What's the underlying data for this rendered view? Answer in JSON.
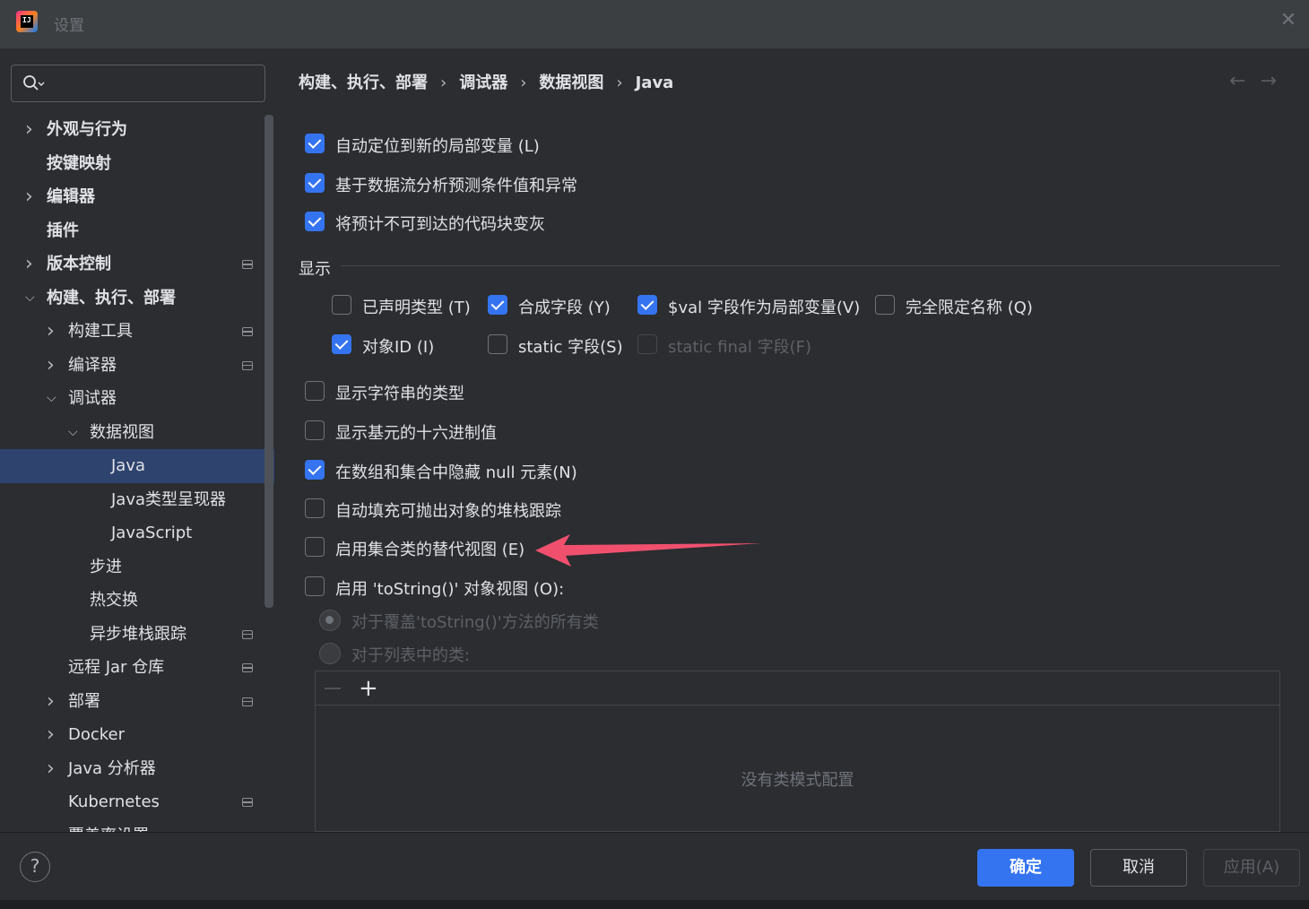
{
  "window": {
    "title": "设置"
  },
  "search": {
    "placeholder": ""
  },
  "sidebar": {
    "items": [
      {
        "label": "外观与行为",
        "bold": true,
        "chevron": "right",
        "indent": 0,
        "pin": false
      },
      {
        "label": "按键映射",
        "bold": true,
        "chevron": "",
        "indent": 0,
        "pin": false
      },
      {
        "label": "编辑器",
        "bold": true,
        "chevron": "right",
        "indent": 0,
        "pin": false
      },
      {
        "label": "插件",
        "bold": true,
        "chevron": "",
        "indent": 0,
        "pin": false
      },
      {
        "label": "版本控制",
        "bold": true,
        "chevron": "right",
        "indent": 0,
        "pin": true
      },
      {
        "label": "构建、执行、部署",
        "bold": true,
        "chevron": "down",
        "indent": 0,
        "pin": false
      },
      {
        "label": "构建工具",
        "bold": false,
        "chevron": "right",
        "indent": 1,
        "pin": true
      },
      {
        "label": "编译器",
        "bold": false,
        "chevron": "right",
        "indent": 1,
        "pin": true
      },
      {
        "label": "调试器",
        "bold": false,
        "chevron": "down",
        "indent": 1,
        "pin": false
      },
      {
        "label": "数据视图",
        "bold": false,
        "chevron": "down",
        "indent": 2,
        "pin": false
      },
      {
        "label": "Java",
        "bold": false,
        "chevron": "",
        "indent": 3,
        "pin": false,
        "selected": true
      },
      {
        "label": "Java类型呈现器",
        "bold": false,
        "chevron": "",
        "indent": 3,
        "pin": false
      },
      {
        "label": "JavaScript",
        "bold": false,
        "chevron": "",
        "indent": 3,
        "pin": false
      },
      {
        "label": "步进",
        "bold": false,
        "chevron": "",
        "indent": 2,
        "pin": false
      },
      {
        "label": "热交换",
        "bold": false,
        "chevron": "",
        "indent": 2,
        "pin": false
      },
      {
        "label": "异步堆栈跟踪",
        "bold": false,
        "chevron": "",
        "indent": 2,
        "pin": true
      },
      {
        "label": "远程 Jar 仓库",
        "bold": false,
        "chevron": "",
        "indent": 1,
        "pin": true
      },
      {
        "label": "部署",
        "bold": false,
        "chevron": "right",
        "indent": 1,
        "pin": true
      },
      {
        "label": "Docker",
        "bold": false,
        "chevron": "right",
        "indent": 1,
        "pin": false
      },
      {
        "label": "Java 分析器",
        "bold": false,
        "chevron": "right",
        "indent": 1,
        "pin": false
      },
      {
        "label": "Kubernetes",
        "bold": false,
        "chevron": "",
        "indent": 1,
        "pin": true
      },
      {
        "label": "覆盖率设置",
        "bold": false,
        "chevron": "",
        "indent": 1,
        "pin": false
      }
    ]
  },
  "breadcrumb": [
    "构建、执行、部署",
    "调试器",
    "数据视图",
    "Java"
  ],
  "nav": {
    "back": "←",
    "forward": "→"
  },
  "options_top": [
    {
      "label": "自动定位到新的局部变量 (L)",
      "checked": true
    },
    {
      "label": "基于数据流分析预测条件值和异常",
      "checked": true
    },
    {
      "label": "将预计不可到达的代码块变灰",
      "checked": true
    }
  ],
  "display": {
    "title": "显示",
    "row1": [
      {
        "label": "已声明类型 (T)",
        "checked": false,
        "disabled": false
      },
      {
        "label": "合成字段 (Y)",
        "checked": true,
        "disabled": false
      },
      {
        "label": "$val 字段作为局部变量(V)",
        "checked": true,
        "disabled": false
      },
      {
        "label": "完全限定名称 (Q)",
        "checked": false,
        "disabled": false
      }
    ],
    "row2": [
      {
        "label": "对象ID (I)",
        "checked": true,
        "disabled": false
      },
      {
        "label": "static 字段(S)",
        "checked": false,
        "disabled": false
      },
      {
        "label": "static final 字段(F)",
        "checked": false,
        "disabled": true
      }
    ]
  },
  "options_mid": [
    {
      "label": "显示字符串的类型",
      "checked": false
    },
    {
      "label": "显示基元的十六进制值",
      "checked": false
    },
    {
      "label": "在数组和集合中隐藏 null 元素(N)",
      "checked": true
    },
    {
      "label": "自动填充可抛出对象的堆栈跟踪",
      "checked": false
    },
    {
      "label": "启用集合类的替代视图 (E)",
      "checked": false
    },
    {
      "label": "启用 'toString()' 对象视图 (O):",
      "checked": false
    }
  ],
  "radios": [
    {
      "label": "对于覆盖'toString()'方法的所有类",
      "selected": true
    },
    {
      "label": "对于列表中的类:",
      "selected": false
    }
  ],
  "list": {
    "add": "+",
    "empty_text": "没有类模式配置"
  },
  "footer": {
    "help": "?",
    "ok": "确定",
    "cancel": "取消",
    "apply": "应用(A)"
  },
  "colors": {
    "accent": "#3574f0",
    "arrow": "#f0506e",
    "selection": "#2e436e"
  }
}
